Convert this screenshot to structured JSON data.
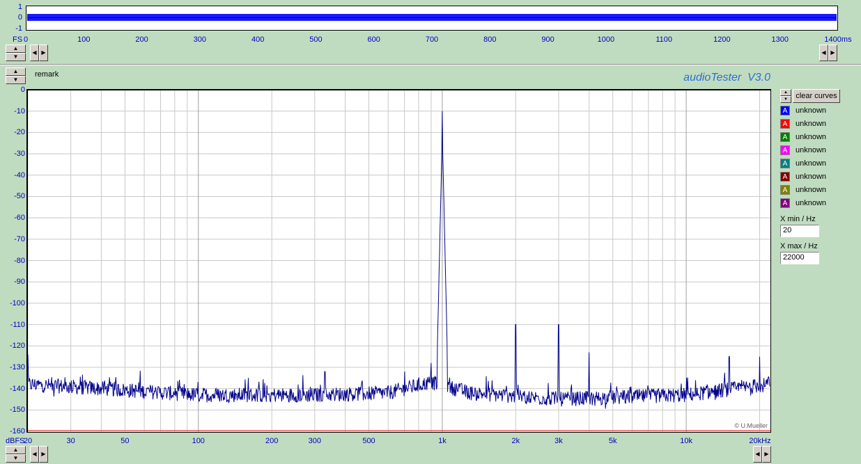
{
  "top_strip": {
    "y_ticks": [
      "1",
      "0",
      "-1"
    ],
    "fs_label": "FS",
    "x_ticks": [
      "0",
      "100",
      "200",
      "300",
      "400",
      "500",
      "600",
      "700",
      "800",
      "900",
      "1000",
      "1100",
      "1200",
      "1300",
      "1400ms"
    ]
  },
  "remark_label": "remark",
  "app_title": "audioTester  V3.0",
  "spectrum": {
    "y_ticks": [
      "0",
      "-10",
      "-20",
      "-30",
      "-40",
      "-50",
      "-60",
      "-70",
      "-80",
      "-90",
      "-100",
      "-110",
      "-120",
      "-130",
      "-140",
      "-150",
      "-160"
    ],
    "y_unit_label": "dBFS",
    "x_ticks": [
      "20",
      "30",
      "50",
      "100",
      "200",
      "300",
      "500",
      "1k",
      "2k",
      "3k",
      "5k",
      "10k",
      "20kHz"
    ],
    "copyright": "© U.Mueller"
  },
  "legend": {
    "clear_button": "clear curves",
    "entries": [
      {
        "label": "unknown",
        "color": "#0000ff"
      },
      {
        "label": "unknown",
        "color": "#ff0000"
      },
      {
        "label": "unknown",
        "color": "#008000"
      },
      {
        "label": "unknown",
        "color": "#ff00ff"
      },
      {
        "label": "unknown",
        "color": "#008080"
      },
      {
        "label": "unknown",
        "color": "#800000"
      },
      {
        "label": "unknown",
        "color": "#808000"
      },
      {
        "label": "unknown",
        "color": "#800080"
      }
    ],
    "swatch_glyph": "A"
  },
  "xrange": {
    "min_label": "X min / Hz",
    "min_value": "20",
    "max_label": "X max / Hz",
    "max_value": "22000"
  },
  "chart_data": [
    {
      "type": "line",
      "title": "",
      "xlabel": "ms",
      "ylabel": "FS",
      "xlim": [
        0,
        1400
      ],
      "ylim": [
        -1,
        1
      ],
      "series": [
        {
          "x": [
            0,
            1400
          ],
          "band": [
            -0.2,
            0.2
          ]
        }
      ]
    },
    {
      "type": "line",
      "title": "",
      "xlabel": "Hz",
      "ylabel": "dBFS",
      "xscale": "log",
      "xlim": [
        20,
        22000
      ],
      "ylim": [
        -160,
        0
      ],
      "grid": true,
      "series": [
        {
          "color": "#00008b",
          "x": [
            20,
            25,
            40,
            60,
            100,
            160,
            200,
            330,
            500,
            700,
            900,
            960,
            980,
            1000,
            1020,
            1040,
            1100,
            1500,
            2000,
            2500,
            3000,
            3500,
            4000,
            6000,
            10000,
            15000,
            20000,
            22000
          ],
          "y": [
            -124,
            -138,
            -140,
            -141,
            -143,
            -135,
            -143,
            -132,
            -143,
            -132,
            -128,
            -126,
            -120,
            -10,
            -120,
            -130,
            -138,
            -145,
            -110,
            -143,
            -110,
            -143,
            -123,
            -144,
            -138,
            -125,
            -125,
            -140
          ]
        }
      ]
    }
  ]
}
